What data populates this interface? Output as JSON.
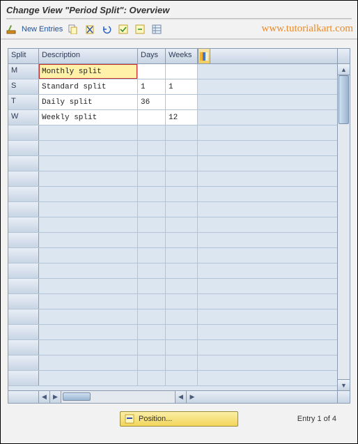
{
  "title": "Change View \"Period Split\": Overview",
  "watermark": "www.tutorialkart.com",
  "toolbar": {
    "new_entries_label": "New Entries"
  },
  "columns": {
    "split": "Split",
    "description": "Description",
    "days": "Days",
    "weeks": "Weeks"
  },
  "rows": [
    {
      "split": "M",
      "description": "Monthly split",
      "days": "",
      "weeks": "",
      "selected": true
    },
    {
      "split": "S",
      "description": "Standard split",
      "days": "1",
      "weeks": "1",
      "selected": false
    },
    {
      "split": "T",
      "description": "Daily split",
      "days": "36",
      "weeks": "",
      "selected": false
    },
    {
      "split": "W",
      "description": "Weekly split",
      "days": "",
      "weeks": "12",
      "selected": false
    }
  ],
  "empty_row_count": 17,
  "footer": {
    "position_label": "Position...",
    "entry_label": "Entry 1 of 4"
  }
}
